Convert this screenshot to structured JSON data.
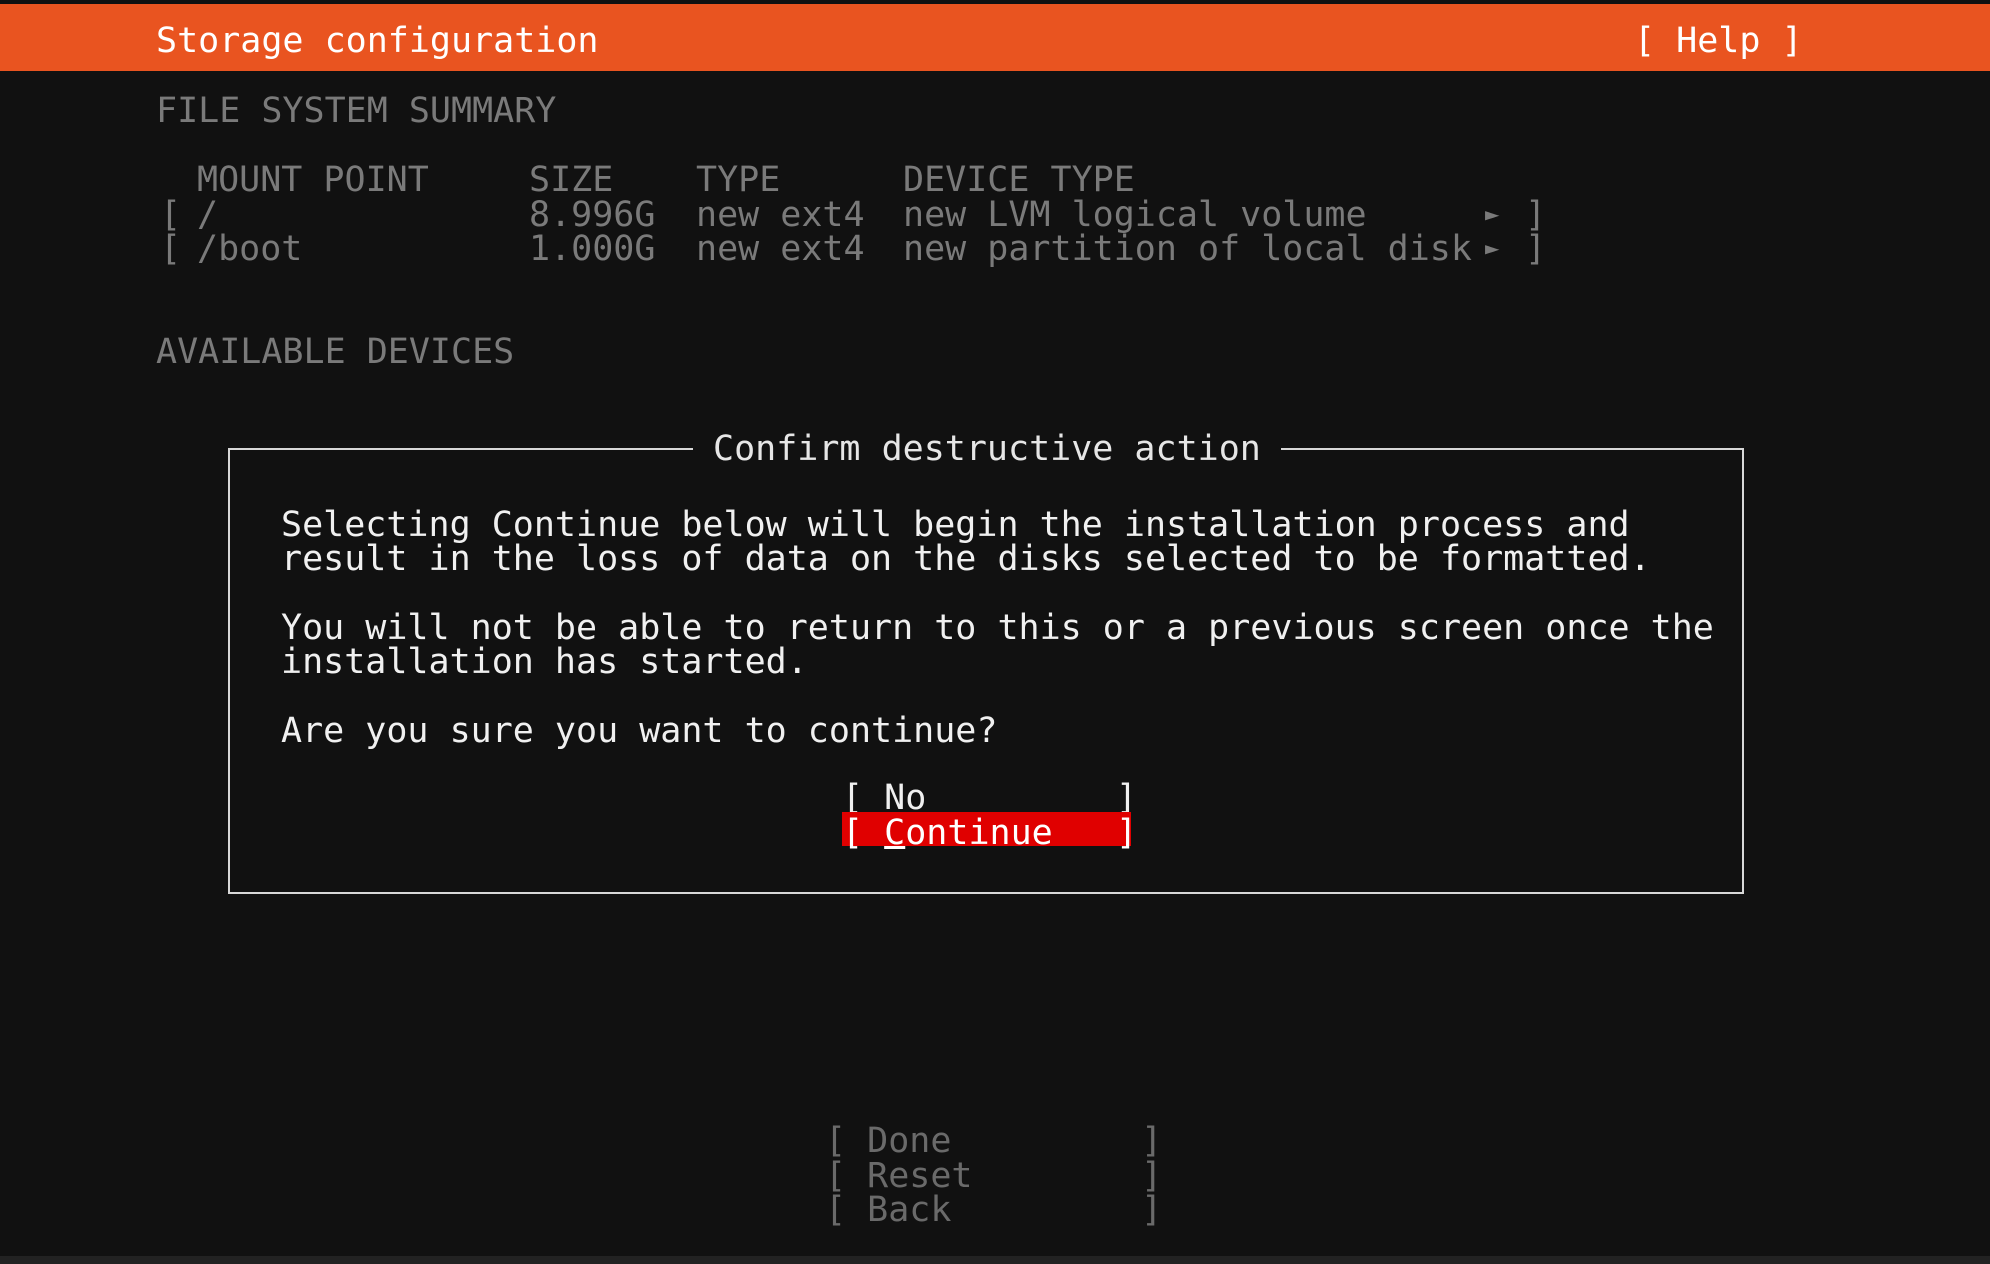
{
  "header": {
    "title": "Storage configuration",
    "help": "[ Help ]",
    "color": "#e95420"
  },
  "summary": {
    "heading": "FILE SYSTEM SUMMARY",
    "columns": [
      "MOUNT POINT",
      "SIZE",
      "TYPE",
      "DEVICE TYPE"
    ],
    "rows": [
      {
        "open": "[",
        "mount": "/",
        "size": "8.996G",
        "type": "new ext4",
        "device": "new LVM logical volume",
        "arrow": "►",
        "close": "]"
      },
      {
        "open": "[",
        "mount": "/boot",
        "size": "1.000G",
        "type": "new ext4",
        "device": "new partition of local disk",
        "arrow": "►",
        "close": "]"
      }
    ]
  },
  "available": {
    "heading": "AVAILABLE DEVICES"
  },
  "dialog": {
    "title": "Confirm destructive action",
    "lines": [
      "Selecting Continue below will begin the installation process and",
      "result in the loss of data on the disks selected to be formatted.",
      "You will not be able to return to this or a previous screen once the",
      "installation has started.",
      "Are you sure you want to continue?"
    ],
    "no_label": "[ No         ]",
    "continue_open": "[ ",
    "continue_first": "C",
    "continue_rest": "ontinue   ]",
    "continue_color": "#e00000"
  },
  "footer_buttons": {
    "done": "[ Done         ]",
    "reset": "[ Reset        ]",
    "back": "[ Back         ]"
  }
}
